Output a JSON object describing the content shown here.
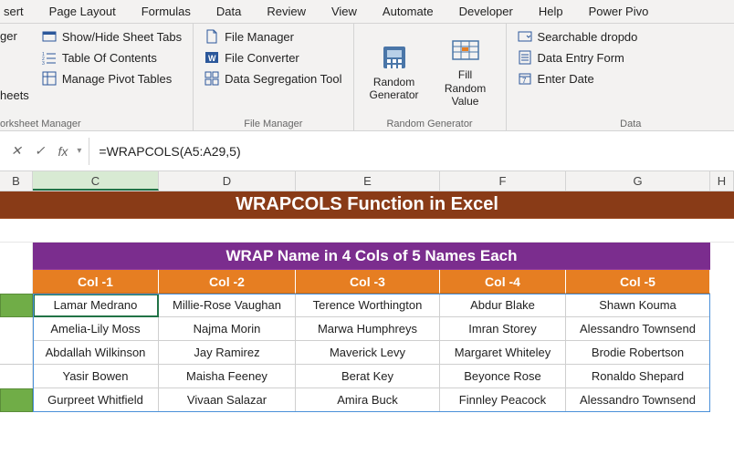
{
  "ribbon": {
    "tabs": [
      "sert",
      "Page Layout",
      "Formulas",
      "Data",
      "Review",
      "View",
      "Automate",
      "Developer",
      "Help",
      "Power Pivo"
    ],
    "groups": {
      "worksheet": {
        "label": "orksheet Manager",
        "items": [
          "ger",
          "Show/Hide Sheet Tabs",
          "Table Of Contents",
          "heets",
          "Manage Pivot Tables"
        ]
      },
      "file": {
        "label": "File Manager",
        "items": [
          "File Manager",
          "File Converter",
          "Data Segregation Tool"
        ]
      },
      "random": {
        "label": "Random Generator",
        "items": [
          "Random Generator",
          "Fill Random Value"
        ]
      },
      "data": {
        "label": "Data",
        "items": [
          "Searchable dropdo",
          "Data Entry Form",
          "Enter Date"
        ]
      }
    }
  },
  "formula_bar": {
    "fx": "fx",
    "formula": "=WRAPCOLS(A5:A29,5)"
  },
  "columns": [
    "B",
    "C",
    "D",
    "E",
    "F",
    "G",
    "H"
  ],
  "sheet": {
    "title": "WRAPCOLS Function in Excel",
    "subtitle": "WRAP Name in 4 Cols of 5 Names Each",
    "headers": [
      "Col -1",
      "Col -2",
      "Col -3",
      "Col -4",
      "Col -5"
    ]
  },
  "chart_data": {
    "type": "table",
    "title": "WRAP Name in 4 Cols of 5 Names Each",
    "columns": [
      "Col -1",
      "Col -2",
      "Col -3",
      "Col -4",
      "Col -5"
    ],
    "rows": [
      [
        "Lamar Medrano",
        "Millie-Rose Vaughan",
        "Terence Worthington",
        "Abdur Blake",
        "Shawn Kouma"
      ],
      [
        "Amelia-Lily Moss",
        "Najma Morin",
        "Marwa Humphreys",
        "Imran Storey",
        "Alessandro Townsend"
      ],
      [
        "Abdallah Wilkinson",
        "Jay Ramirez",
        "Maverick Levy",
        "Margaret Whiteley",
        "Brodie Robertson"
      ],
      [
        "Yasir Bowen",
        "Maisha Feeney",
        "Berat Key",
        "Beyonce Rose",
        "Ronaldo Shepard"
      ],
      [
        "Gurpreet Whitfield",
        "Vivaan Salazar",
        "Amira Buck",
        "Finnley Peacock",
        "Alessandro Townsend"
      ]
    ]
  }
}
